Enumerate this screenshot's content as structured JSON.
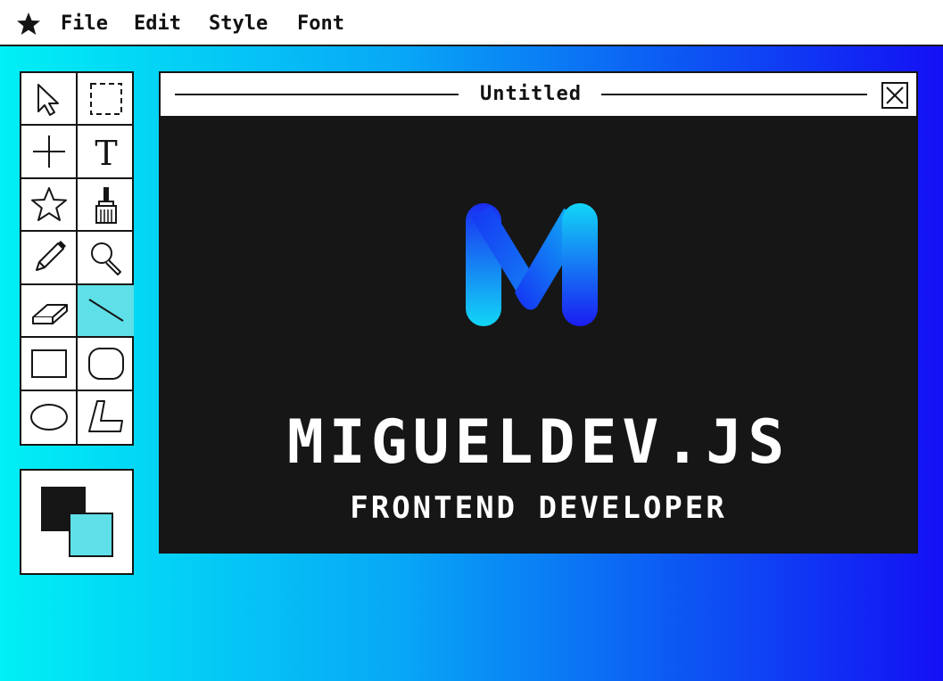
{
  "menubar": {
    "logo_icon": "star-icon",
    "items": [
      {
        "label": "File"
      },
      {
        "label": "Edit"
      },
      {
        "label": "Style"
      },
      {
        "label": "Font"
      }
    ]
  },
  "toolbox": {
    "tools": [
      {
        "icon": "arrow-select-icon"
      },
      {
        "icon": "rect-select-icon"
      },
      {
        "icon": "crosshair-icon"
      },
      {
        "icon": "text-tool-icon",
        "glyph": "T"
      },
      {
        "icon": "star-shape-icon"
      },
      {
        "icon": "brush-icon"
      },
      {
        "icon": "pencil-icon"
      },
      {
        "icon": "magnifier-icon"
      },
      {
        "icon": "eraser-icon"
      },
      {
        "icon": "line-tool-icon",
        "active": true
      },
      {
        "icon": "rectangle-icon"
      },
      {
        "icon": "rounded-rectangle-icon"
      },
      {
        "icon": "ellipse-icon"
      },
      {
        "icon": "polygon-icon"
      }
    ]
  },
  "colors": {
    "foreground": "#161616",
    "background": "#5fe0e8",
    "accent": "#5fe0e8",
    "desktop_gradient": [
      "#00f0f5",
      "#1410f5"
    ]
  },
  "window": {
    "title": "Untitled",
    "close_icon": "close-icon"
  },
  "canvas": {
    "logo_icon": "m-logo-icon",
    "headline": "MIGUELDEV.JS",
    "subline": "FRONTEND DEVELOPER"
  }
}
